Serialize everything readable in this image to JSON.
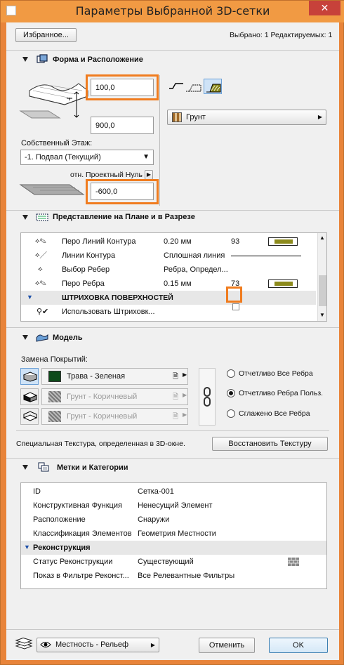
{
  "window": {
    "title": "Параметры Выбранной 3D-сетки",
    "close": "✕"
  },
  "header": {
    "favorites": "Избранное...",
    "selection_info": "Выбрано: 1 Редактируемых: 1"
  },
  "geometry": {
    "section_title": "Форма и Расположение",
    "top_value": "100,0",
    "thickness_value": "900,0",
    "story_label": "Собственный Этаж:",
    "story_value": "-1. Подвал (Текущий)",
    "ref_label": "отн. Проектный Нуль",
    "elevation_value": "-600,0",
    "material": "Грунт"
  },
  "floorplan": {
    "section_title": "Представление на Плане и в Разрезе",
    "rows": [
      {
        "label": "Перо Линий Контура",
        "value": "0.20 мм",
        "num": "93"
      },
      {
        "label": "Линии Контура",
        "value": "Сплошная линия"
      },
      {
        "label": "Выбор Ребер",
        "value": "Ребра, Определ..."
      },
      {
        "label": "Перо Ребра",
        "value": "0.15 мм",
        "num": "73"
      }
    ],
    "group_header": "ШТРИХОВКА ПОВЕРХНОСТЕЙ",
    "use_hatch": "Использовать Штриховк..."
  },
  "model": {
    "section_title": "Модель",
    "override_label": "Замена Покрытий:",
    "surfaces": [
      {
        "name": "Трава - Зеленая",
        "color": "#0d4a1a"
      },
      {
        "name": "Грунт - Коричневый"
      },
      {
        "name": "Грунт - Коричневый"
      }
    ],
    "radios": [
      "Отчетливо Все Ребра",
      "Отчетливо Ребра Польз.",
      "Сглажено Все Ребра"
    ],
    "texture_note": "Специальная Текстура, определенная в 3D-окне.",
    "restore_button": "Восстановить Текстуру"
  },
  "tags": {
    "section_title": "Метки и Категории",
    "rows": [
      {
        "label": "ID",
        "value": "Сетка-001"
      },
      {
        "label": "Конструктивная Функция",
        "value": "Ненесущий Элемент"
      },
      {
        "label": "Расположение",
        "value": "Снаружи"
      },
      {
        "label": "Классификация Элементов",
        "value": "Геометрия Местности"
      }
    ],
    "group_header": "Реконструкция",
    "rows2": [
      {
        "label": "Статус Реконструкции",
        "value": "Существующий"
      },
      {
        "label": "Показ в Фильтре Реконст...",
        "value": "Все Релевантные Фильтры"
      }
    ]
  },
  "footer": {
    "layer": "Местность - Рельеф",
    "cancel": "Отменить",
    "ok": "OK"
  },
  "colors": {
    "accent": "#f07c1f",
    "pen_bar": "#8c8a1c",
    "radio_dot": "#111111"
  }
}
